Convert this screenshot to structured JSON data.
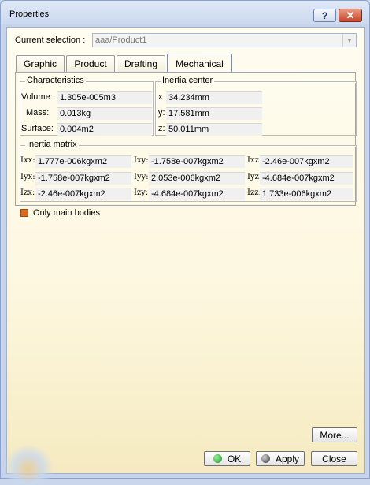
{
  "window": {
    "title": "Properties",
    "help_glyph": "?",
    "close_glyph": "✕"
  },
  "selection": {
    "label": "Current selection :",
    "value": "aaa/Product1"
  },
  "tabs": [
    "Graphic",
    "Product",
    "Drafting",
    "Mechanical"
  ],
  "active_tab": "Mechanical",
  "characteristics": {
    "title": "Characteristics",
    "rows": [
      {
        "label": "Volume:",
        "value": "1.305e-005m3"
      },
      {
        "label": "Mass:",
        "value": "0.013kg"
      },
      {
        "label": "Surface:",
        "value": "0.004m2"
      }
    ]
  },
  "inertia_center": {
    "title": "Inertia center",
    "rows": [
      {
        "label": "x:",
        "value": "34.234mm"
      },
      {
        "label": "y:",
        "value": "17.581mm"
      },
      {
        "label": "z:",
        "value": "50.011mm"
      }
    ]
  },
  "inertia_matrix": {
    "title": "Inertia matrix",
    "rows": [
      [
        {
          "label": "Ixx:",
          "value": "1.777e-006kgxm2"
        },
        {
          "label": "Ixy:",
          "value": "-1.758e-007kgxm2"
        },
        {
          "label": "Ixz:",
          "value": "-2.46e-007kgxm2"
        }
      ],
      [
        {
          "label": "Iyx:",
          "value": "-1.758e-007kgxm2"
        },
        {
          "label": "Iyy:",
          "value": "2.053e-006kgxm2"
        },
        {
          "label": "Iyz:",
          "value": "-4.684e-007kgxm2"
        }
      ],
      [
        {
          "label": "Izx:",
          "value": "-2.46e-007kgxm2"
        },
        {
          "label": "Izy:",
          "value": "-4.684e-007kgxm2"
        },
        {
          "label": "Izz:",
          "value": "1.733e-006kgxm2"
        }
      ]
    ]
  },
  "only_main_bodies": {
    "label": "Only main bodies",
    "checked": true
  },
  "buttons": {
    "more": "More...",
    "ok": "OK",
    "apply": "Apply",
    "close": "Close"
  },
  "colors": {
    "accent_checkbox": "#d86a1e",
    "ok_icon": "#1b8f1b"
  }
}
